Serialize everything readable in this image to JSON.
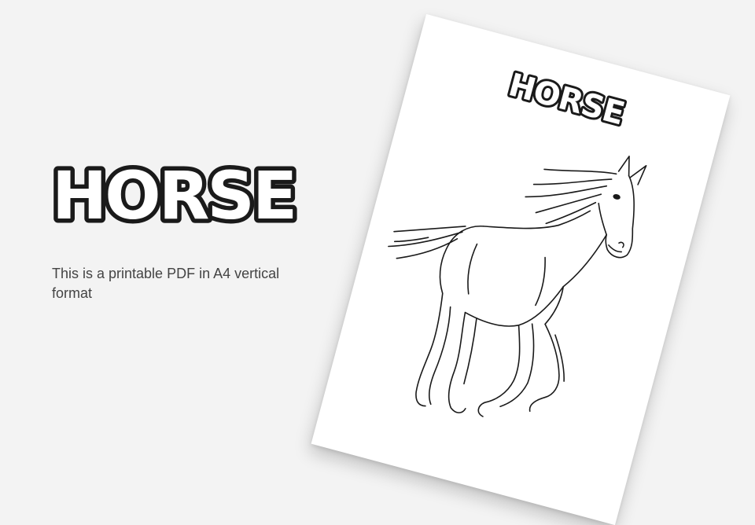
{
  "slide": {
    "title": "HORSE",
    "description": "This is a printable PDF in A4 vertical format"
  },
  "preview_page": {
    "title": "HORSE",
    "illustration_name": "horse-coloring-illustration"
  },
  "colors": {
    "background": "#f3f3f3",
    "page": "#ffffff",
    "outline": "#1a1a1a",
    "text": "#444444"
  }
}
